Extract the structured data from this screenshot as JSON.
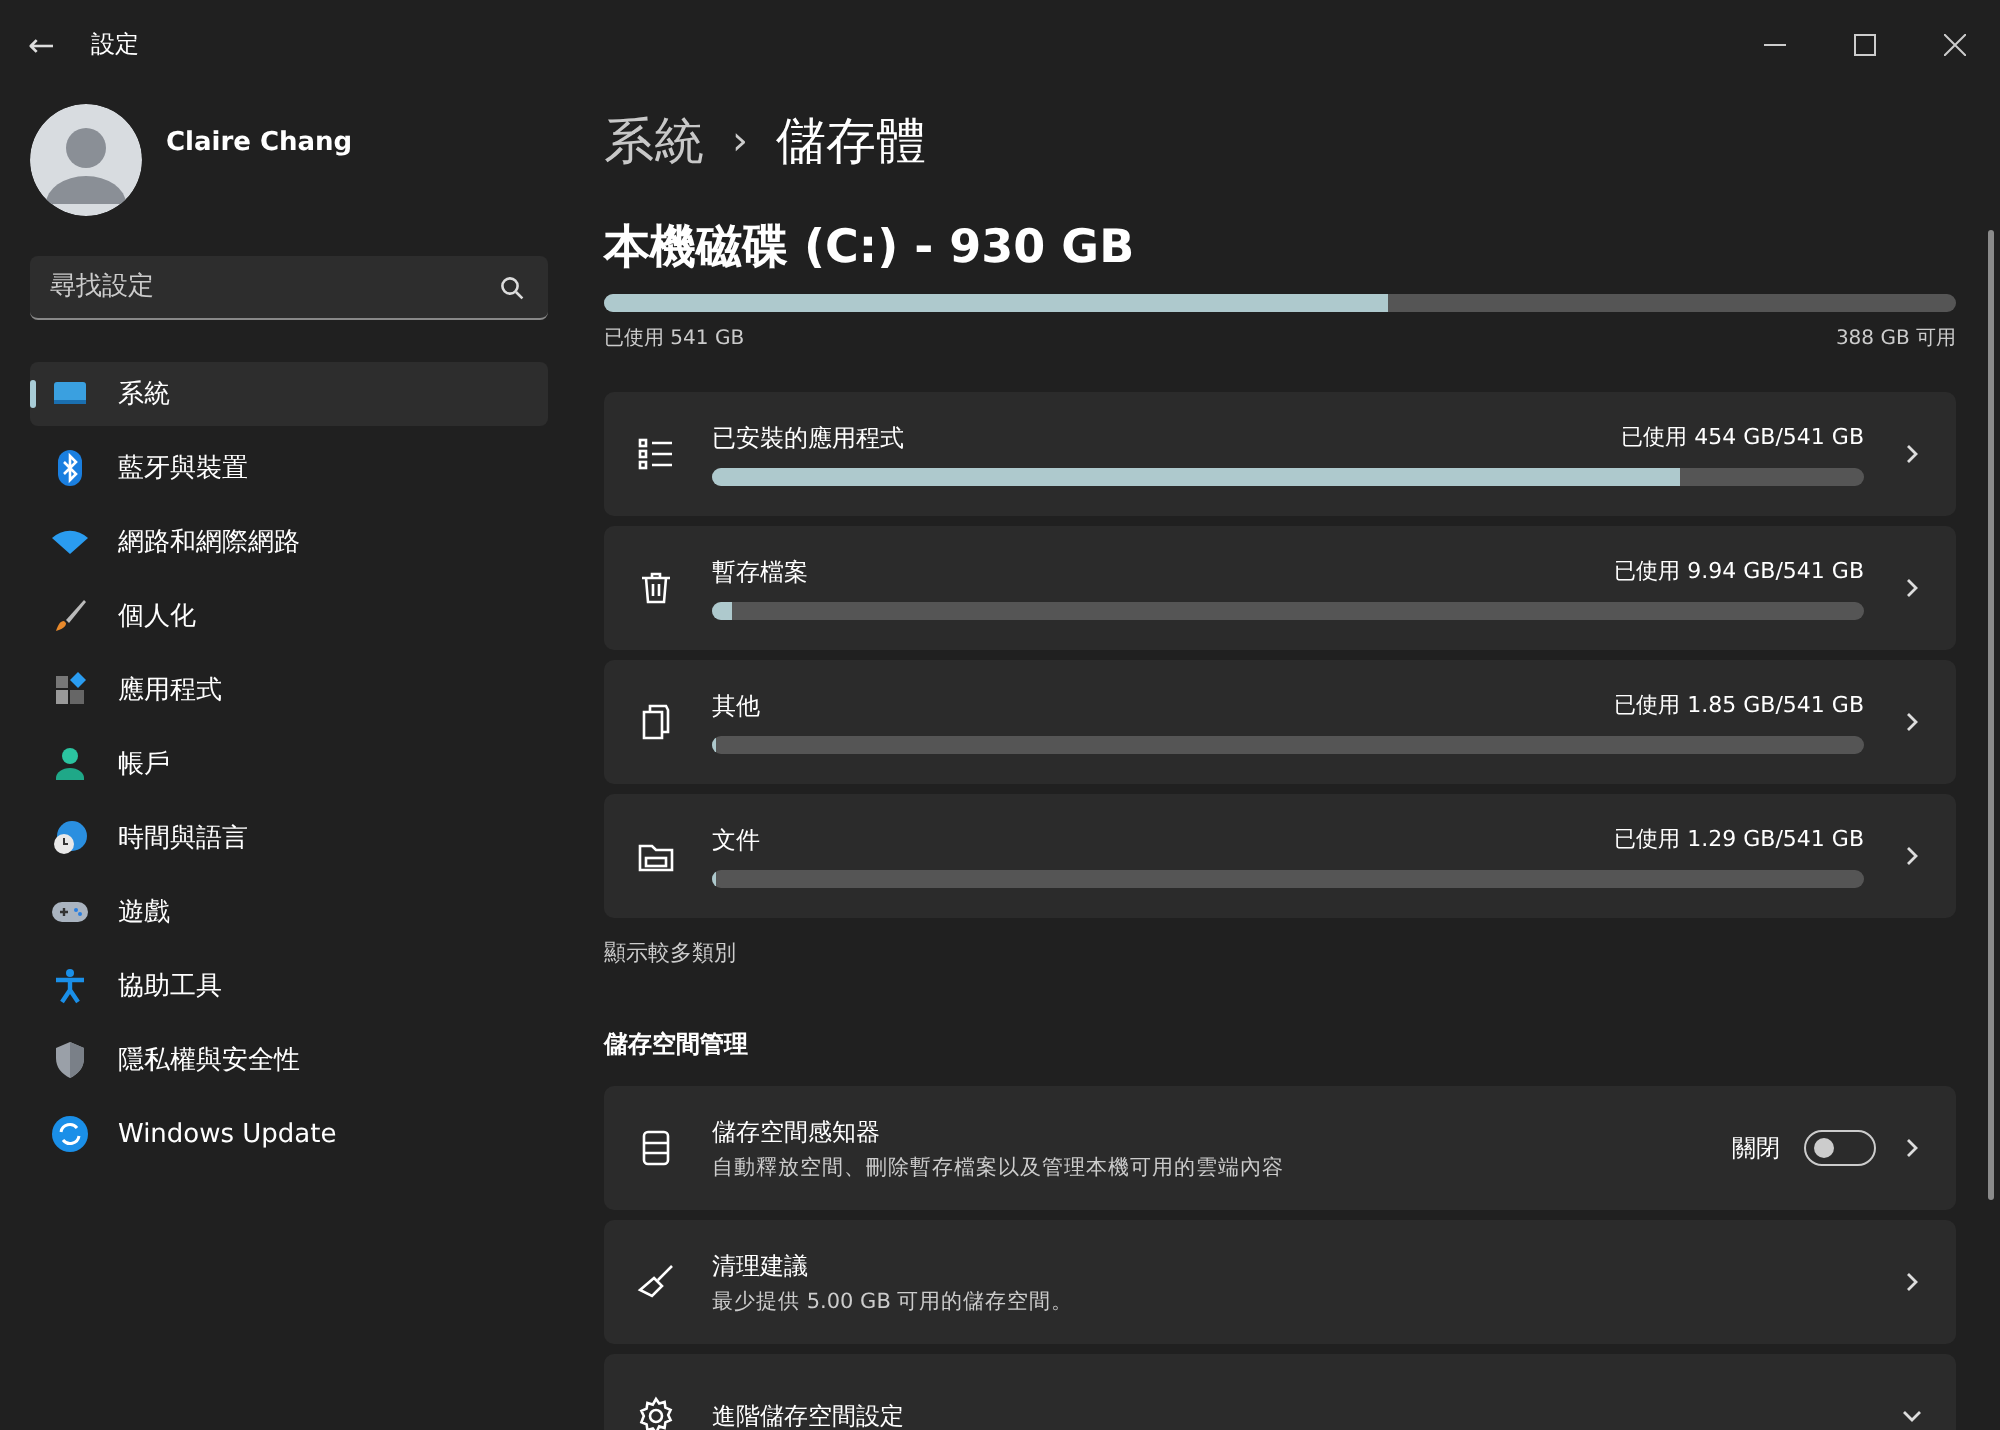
{
  "window": {
    "title": "設定",
    "back": "←"
  },
  "user": {
    "name": "Claire Chang"
  },
  "search": {
    "placeholder": "尋找設定"
  },
  "sidebar": {
    "items": [
      {
        "label": "系統",
        "selected": true
      },
      {
        "label": "藍牙與裝置",
        "selected": false
      },
      {
        "label": "網路和網際網路",
        "selected": false
      },
      {
        "label": "個人化",
        "selected": false
      },
      {
        "label": "應用程式",
        "selected": false
      },
      {
        "label": "帳戶",
        "selected": false
      },
      {
        "label": "時間與語言",
        "selected": false
      },
      {
        "label": "遊戲",
        "selected": false
      },
      {
        "label": "協助工具",
        "selected": false
      },
      {
        "label": "隱私權與安全性",
        "selected": false
      },
      {
        "label": "Windows Update",
        "selected": false
      }
    ]
  },
  "breadcrumb": {
    "parent": "系統",
    "separator": "›",
    "current": "儲存體"
  },
  "drive": {
    "title": "本機磁碟 (C:) - 930 GB",
    "level": 0.58,
    "used": "已使用 541 GB",
    "free": "388 GB 可用"
  },
  "categories": [
    {
      "name": "已安裝的應用程式",
      "usage": "已使用 454 GB/541 GB",
      "level": 0.84
    },
    {
      "name": "暫存檔案",
      "usage": "已使用 9.94 GB/541 GB",
      "level": 0.018
    },
    {
      "name": "其他",
      "usage": "已使用 1.85 GB/541 GB",
      "level": 0.0034
    },
    {
      "name": "文件",
      "usage": "已使用 1.29 GB/541 GB",
      "level": 0.0024
    }
  ],
  "show_more": "顯示較多類別",
  "management": {
    "heading": "儲存空間管理",
    "items": [
      {
        "kind": "toggle",
        "title": "儲存空間感知器",
        "subtitle": "自動釋放空間、刪除暫存檔案以及管理本機可用的雲端內容",
        "state_label": "關閉",
        "on": false
      },
      {
        "kind": "link",
        "title": "清理建議",
        "subtitle": "最少提供 5.00 GB 可用的儲存空間。"
      },
      {
        "kind": "expander",
        "title": "進階儲存空間設定",
        "expanded": false
      }
    ]
  }
}
